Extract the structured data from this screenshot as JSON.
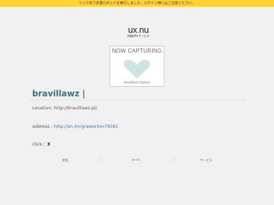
{
  "notice": "リンク先で多重ロボットを実行しました。ログイン時にはご注意ください。",
  "logo": {
    "name_main": "ux",
    "name_dot": ".",
    "name_tld": "nu",
    "tagline": "短縮URLサービス"
  },
  "capture": {
    "title": "NOW CAPTURING",
    "footer": "HeartRails Capture",
    "heart_color": "#cfe3e2"
  },
  "page": {
    "title": "bravillawz |",
    "location_label": "Location:",
    "location_value": "http://bravillawz.pl/",
    "address_label": "address :",
    "address_value": "http://sn.im/grawerton79581",
    "click_label": "click :",
    "click_count": "3"
  },
  "footer": {
    "links": [
      "新生",
      "ux.nu",
      "サービス"
    ]
  }
}
